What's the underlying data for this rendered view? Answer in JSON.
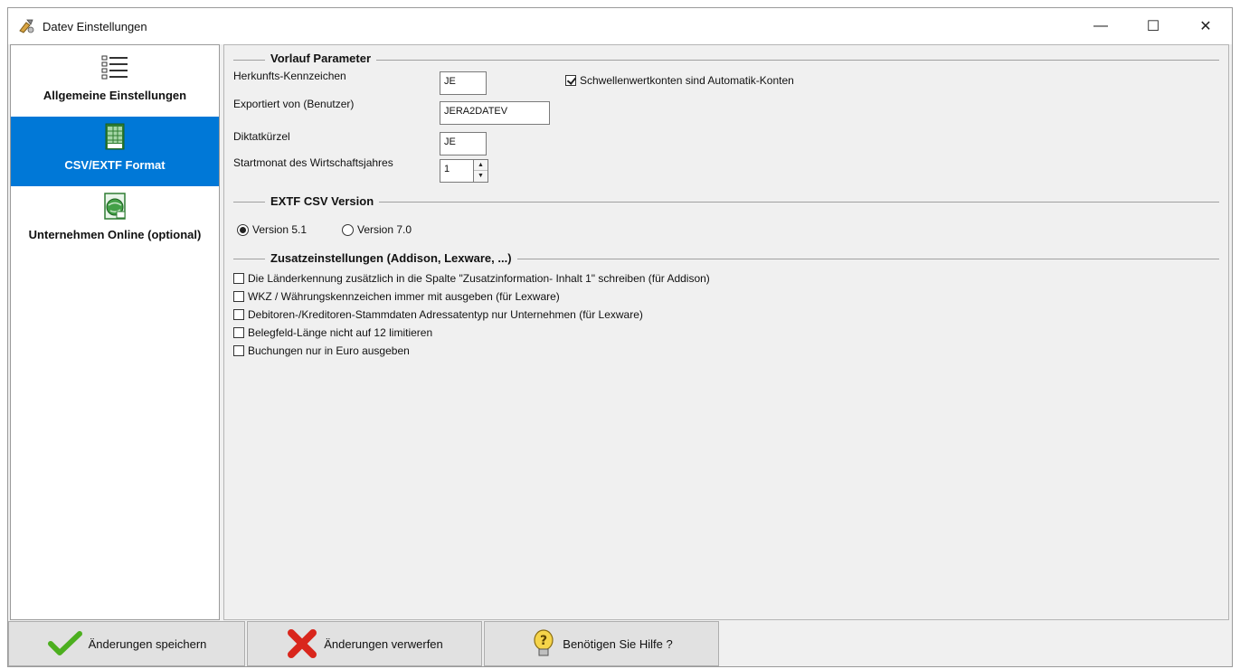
{
  "window": {
    "title": "Datev Einstellungen",
    "app_icon": "settings-app-icon",
    "controls": {
      "minimize": "—",
      "maximize": "☐",
      "close": "✕"
    }
  },
  "sidebar": {
    "items": [
      {
        "label": "Allgemeine Einstellungen",
        "icon": "list-icon",
        "active": false
      },
      {
        "label": "CSV/EXTF Format",
        "icon": "spreadsheet-csv-icon",
        "active": true
      },
      {
        "label": "Unternehmen Online (optional)",
        "icon": "globe-document-icon",
        "active": false
      }
    ]
  },
  "vorlauf": {
    "title": "Vorlauf Parameter",
    "herkunft_label": "Herkunfts-Kennzeichen",
    "herkunft_value": "JE",
    "exportiert_label": "Exportiert von (Benutzer)",
    "exportiert_value": "JERA2DATEV",
    "diktat_label": "Diktatkürzel",
    "diktat_value": "JE",
    "startmonat_label": "Startmonat des Wirtschaftsjahres",
    "startmonat_value": "1",
    "schwellen_label": "Schwellenwertkonten sind Automatik-Konten",
    "schwellen_checked": true
  },
  "extf": {
    "title": "EXTF CSV Version",
    "options": [
      {
        "label": "Version 5.1",
        "checked": true
      },
      {
        "label": "Version 7.0",
        "checked": false
      }
    ]
  },
  "zusatz": {
    "title": "Zusatzeinstellungen (Addison, Lexware, ...)",
    "options": [
      {
        "label": "Die Länderkennung zusätzlich in die Spalte \"Zusatzinformation- Inhalt 1\" schreiben (für Addison)",
        "checked": false
      },
      {
        "label": "WKZ / Währungskennzeichen immer mit ausgeben (für Lexware)",
        "checked": false
      },
      {
        "label": "Debitoren-/Kreditoren-Stammdaten Adressatentyp nur Unternehmen (für Lexware)",
        "checked": false
      },
      {
        "label": "Belegfeld-Länge nicht auf 12 limitieren",
        "checked": false
      },
      {
        "label": "Buchungen nur in Euro ausgeben",
        "checked": false
      }
    ]
  },
  "buttons": {
    "save": "Änderungen speichern",
    "discard": "Änderungen verwerfen",
    "help": "Benötigen Sie Hilfe ?"
  },
  "colors": {
    "accent": "#0078d7",
    "panel": "#f0f0f0",
    "save_check": "#4caf1f",
    "discard_x": "#d9261c"
  }
}
